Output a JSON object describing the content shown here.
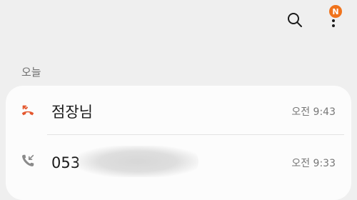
{
  "toolbar": {
    "search_icon": "search-icon",
    "more_icon": "more-vertical-icon",
    "notification_badge": "N",
    "badge_color": "#f0731c"
  },
  "section": {
    "title": "오늘"
  },
  "calls": [
    {
      "name": "점장님",
      "time": "오전 9:43",
      "type": "missed",
      "icon": "missed-call-icon",
      "icon_color": "#e4572e"
    },
    {
      "name": "053",
      "time": "오전 9:33",
      "type": "incoming",
      "icon": "incoming-call-icon",
      "icon_color": "#8a8a8a"
    }
  ]
}
